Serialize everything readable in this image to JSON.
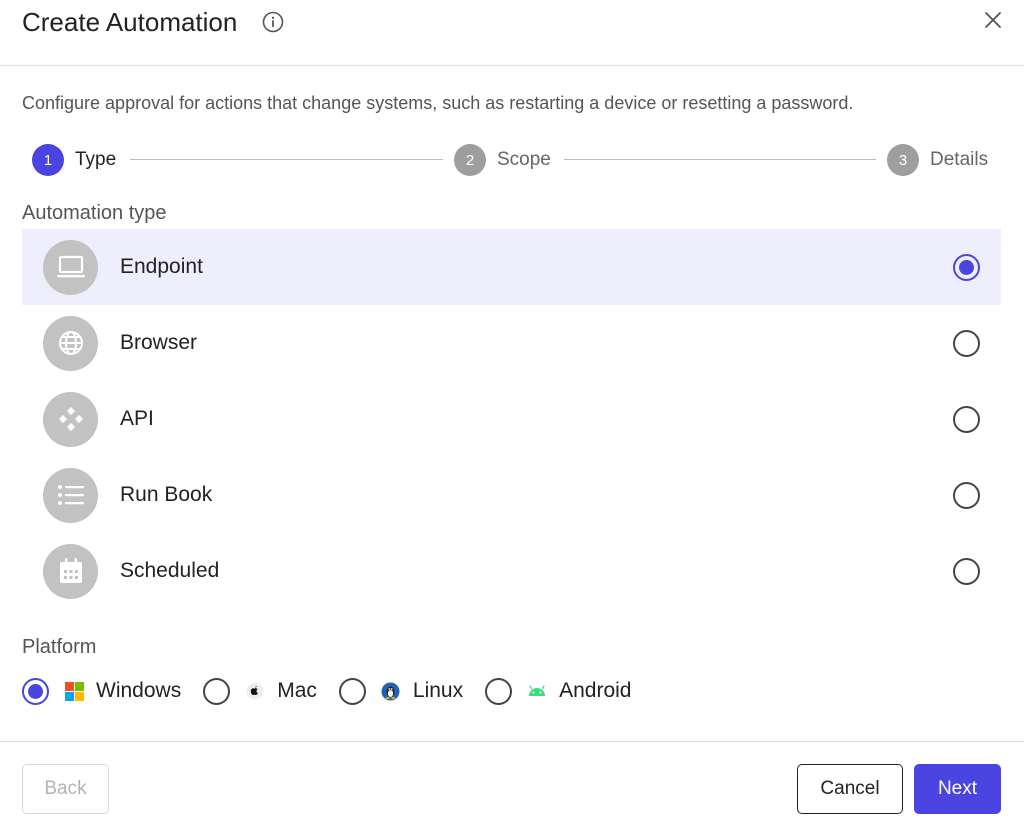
{
  "header": {
    "title": "Create Automation"
  },
  "description": "Configure approval for actions that change systems, such as restarting a device or resetting a password.",
  "steps": [
    {
      "number": "1",
      "label": "Type"
    },
    {
      "number": "2",
      "label": "Scope"
    },
    {
      "number": "3",
      "label": "Details"
    }
  ],
  "automation_type": {
    "label": "Automation type",
    "options": [
      {
        "label": "Endpoint",
        "icon": "laptop-icon",
        "selected": true
      },
      {
        "label": "Browser",
        "icon": "globe-icon",
        "selected": false
      },
      {
        "label": "API",
        "icon": "api-icon",
        "selected": false
      },
      {
        "label": "Run Book",
        "icon": "list-icon",
        "selected": false
      },
      {
        "label": "Scheduled",
        "icon": "calendar-icon",
        "selected": false
      }
    ]
  },
  "platform": {
    "label": "Platform",
    "options": [
      {
        "label": "Windows",
        "icon": "windows-logo-icon",
        "selected": true
      },
      {
        "label": "Mac",
        "icon": "apple-logo-icon",
        "selected": false
      },
      {
        "label": "Linux",
        "icon": "linux-logo-icon",
        "selected": false
      },
      {
        "label": "Android",
        "icon": "android-logo-icon",
        "selected": false
      }
    ]
  },
  "footer": {
    "back_label": "Back",
    "cancel_label": "Cancel",
    "next_label": "Next"
  },
  "colors": {
    "accent": "#4a44e0",
    "selected_row": "#eeeefc",
    "step_inactive": "#9e9e9e",
    "icon_bg": "#c2c2c2"
  }
}
